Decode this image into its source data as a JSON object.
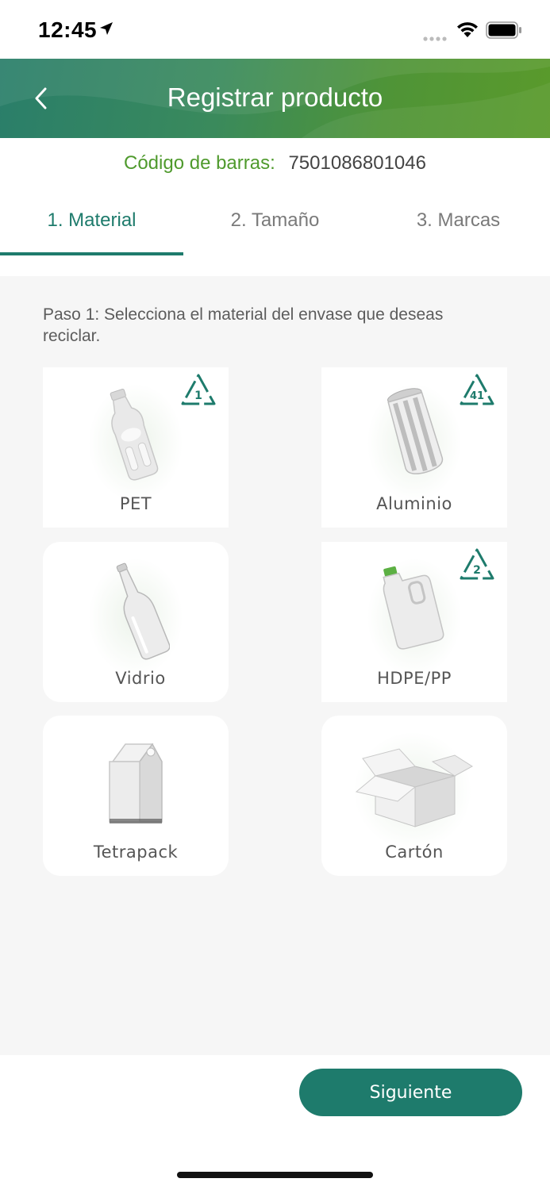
{
  "status_bar": {
    "time": "12:45",
    "icons": [
      "location-arrow-icon",
      "cellular-signal-icon",
      "wifi-icon",
      "battery-icon"
    ]
  },
  "header": {
    "title": "Registrar producto",
    "back_icon": "chevron-left-icon"
  },
  "barcode": {
    "label": "Código de barras:",
    "value": "7501086801046"
  },
  "tabs": [
    {
      "label": "1. Material",
      "active": true
    },
    {
      "label": "2. Tamaño",
      "active": false
    },
    {
      "label": "3. Marcas",
      "active": false
    }
  ],
  "instruction": "Paso 1: Selecciona el material del envase que deseas reciclar.",
  "materials": [
    {
      "label": "PET",
      "icon": "plastic-bottle-icon",
      "recycle_code": "1"
    },
    {
      "label": "Aluminio",
      "icon": "aluminum-can-icon",
      "recycle_code": "41"
    },
    {
      "label": "Vidrio",
      "icon": "glass-bottle-icon"
    },
    {
      "label": "HDPE/PP",
      "icon": "jug-icon",
      "recycle_code": "2"
    },
    {
      "label": "Tetrapack",
      "icon": "milk-carton-icon"
    },
    {
      "label": "Cartón",
      "icon": "cardboard-box-icon"
    }
  ],
  "next_button": {
    "label": "Siguiente"
  },
  "colors": {
    "accent": "#1e7b6c",
    "barcode_label": "#4f9a2d",
    "header_gradient_start": "#2a7e6a",
    "header_gradient_end": "#5a9a2b",
    "background": "#f6f6f6"
  }
}
